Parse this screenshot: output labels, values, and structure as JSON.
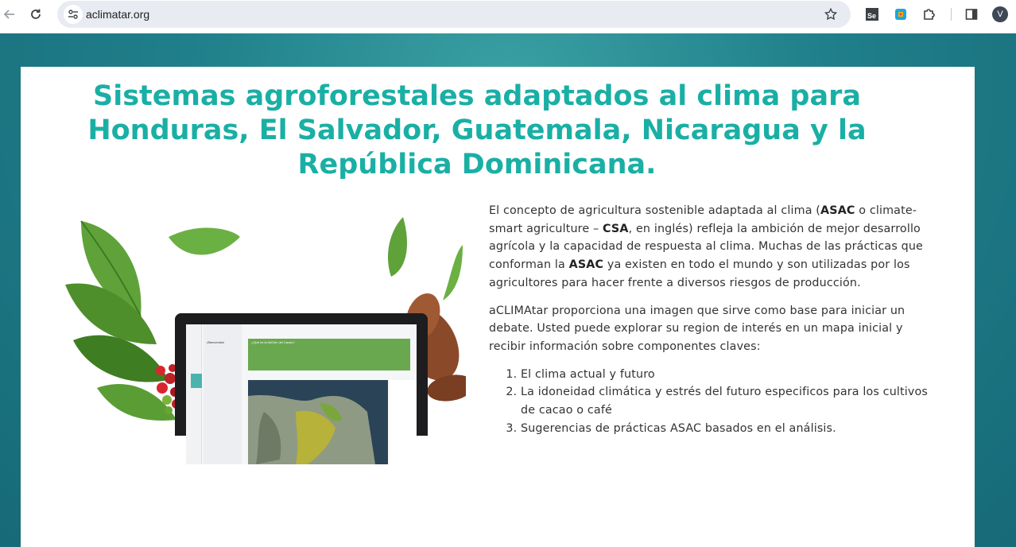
{
  "browser": {
    "url": "aclimatar.org",
    "profile_initial": "V",
    "icons": [
      "back-icon",
      "reload-icon",
      "site-settings-icon",
      "bookmark-star-icon",
      "selenium-extension-icon",
      "color-picker-extension-icon",
      "extensions-puzzle-icon",
      "side-panel-icon"
    ]
  },
  "page": {
    "title": "Sistemas agroforestales adaptados al clima para Honduras, El Salvador, Guatemala, Nicaragua y la República Dominicana.",
    "intro": {
      "p1_a": "El concepto de agricultura sostenible adaptada al clima (",
      "p1_b": "ASAC",
      "p1_c": " o climate-smart agriculture – ",
      "p1_d": "CSA",
      "p1_e": ", en inglés) refleja la ambición de mejor desarrollo agrícola y la capacidad de respuesta al clima. Muchas de las prácticas que conforman la ",
      "p1_f": "ASAC",
      "p1_g": " ya existen en todo el mundo y son utilizadas por los agricultores para hacer frente a diversos riesgos de producción."
    },
    "p2": "aCLIMAtar proporciona una imagen que sirve como base para iniciar un debate. Usted puede explorar su region de interés en un mapa inicial y recibir información sobre componentes claves:",
    "list": [
      "El clima actual y futuro",
      "La idoneidad climática y estrés del futuro especificos para los cultivos de cacao o café",
      "Sugerencias de prácticas ASAC basados en el análisis."
    ],
    "laptop_screen": {
      "welcome": "¡Bienvenido!",
      "panel_title": "¿Qué es la AdClim del Cacao?"
    }
  },
  "colors": {
    "title": "#1aafa5",
    "page_background": "#1f7f8a",
    "screen_header": "#6aa84f"
  }
}
